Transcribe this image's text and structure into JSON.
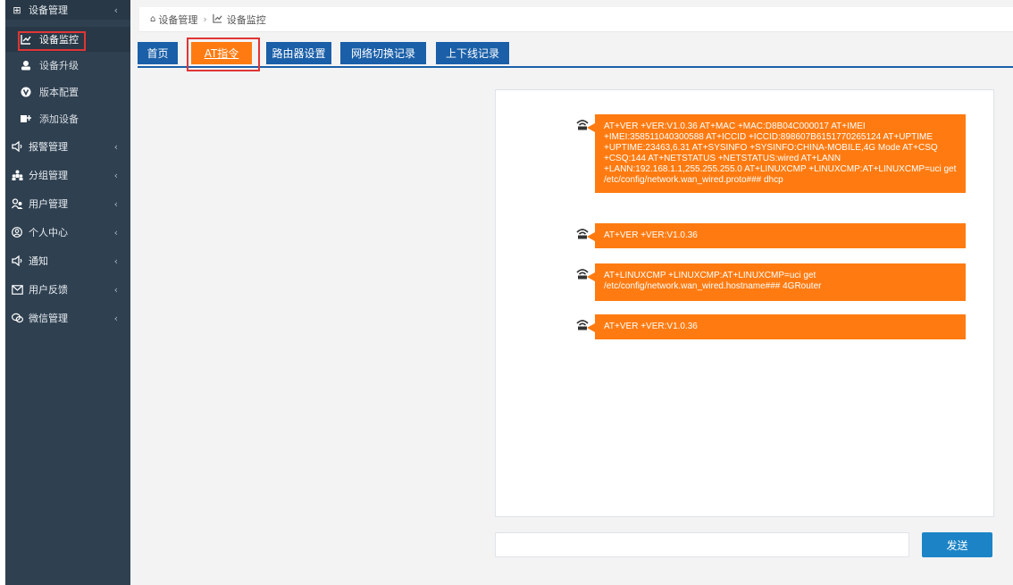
{
  "sidebar": {
    "top": {
      "label": "设备管理",
      "chevron": "‹",
      "icon": "grid-icon"
    },
    "sub_items": [
      {
        "label": "设备监控",
        "icon": "chart-icon"
      },
      {
        "label": "设备升级",
        "icon": "user-icon"
      },
      {
        "label": "版本配置",
        "icon": "circle-v-icon"
      },
      {
        "label": "添加设备",
        "icon": "add-device-icon"
      }
    ],
    "items": [
      {
        "label": "报警管理",
        "chevron": "‹",
        "icon": "speaker-icon"
      },
      {
        "label": "分组管理",
        "chevron": "‹",
        "icon": "group-icon"
      },
      {
        "label": "用户管理",
        "chevron": "‹",
        "icon": "users-icon"
      },
      {
        "label": "个人中心",
        "chevron": "‹",
        "icon": "person-circle-icon"
      },
      {
        "label": "通知",
        "chevron": "‹",
        "icon": "speaker-icon"
      },
      {
        "label": "用户反馈",
        "chevron": "‹",
        "icon": "mail-icon"
      },
      {
        "label": "微信管理",
        "chevron": "‹",
        "icon": "wechat-icon"
      }
    ]
  },
  "breadcrumb": {
    "home_icon": "home-icon",
    "home": "设备管理",
    "sep": "›",
    "current_icon": "chart-icon",
    "current": "设备监控"
  },
  "tabs": [
    {
      "label": "首页"
    },
    {
      "label": "AT指令"
    },
    {
      "label": "路由器设置"
    },
    {
      "label": "网络切换记录"
    },
    {
      "label": "上下线记录"
    }
  ],
  "messages": [
    {
      "icon": "router-icon",
      "text": "AT+VER +VER:V1.0.36 AT+MAC +MAC:D8B04C000017 AT+IMEI +IMEI:358511040300588 AT+ICCID +ICCID:898607B6151770265124 AT+UPTIME +UPTIME:23463,6.31 AT+SYSINFO +SYSINFO:CHINA-MOBILE,4G Mode AT+CSQ +CSQ:144 AT+NETSTATUS +NETSTATUS:wired AT+LANN +LANN:192.168.1.1,255.255.255.0 AT+LINUXCMP +LINUXCMP:AT+LINUXCMP=uci get /etc/config/network.wan_wired.proto### dhcp"
    },
    {
      "icon": "router-icon",
      "text": "AT+VER +VER:V1.0.36"
    },
    {
      "icon": "router-icon",
      "text": "AT+LINUXCMP +LINUXCMP:AT+LINUXCMP=uci get /etc/config/network.wan_wired.hostname### 4GRouter"
    },
    {
      "icon": "router-icon",
      "text": "AT+VER +VER:V1.0.36"
    }
  ],
  "input": {
    "placeholder": ""
  },
  "send_label": "发送",
  "colors": {
    "sidebar": "#2f4050",
    "tab": "#1a5fa8",
    "active_tab": "#ff7b11",
    "bubble": "#ff7b11",
    "send": "#1c84c6",
    "highlight": "#e03535"
  }
}
